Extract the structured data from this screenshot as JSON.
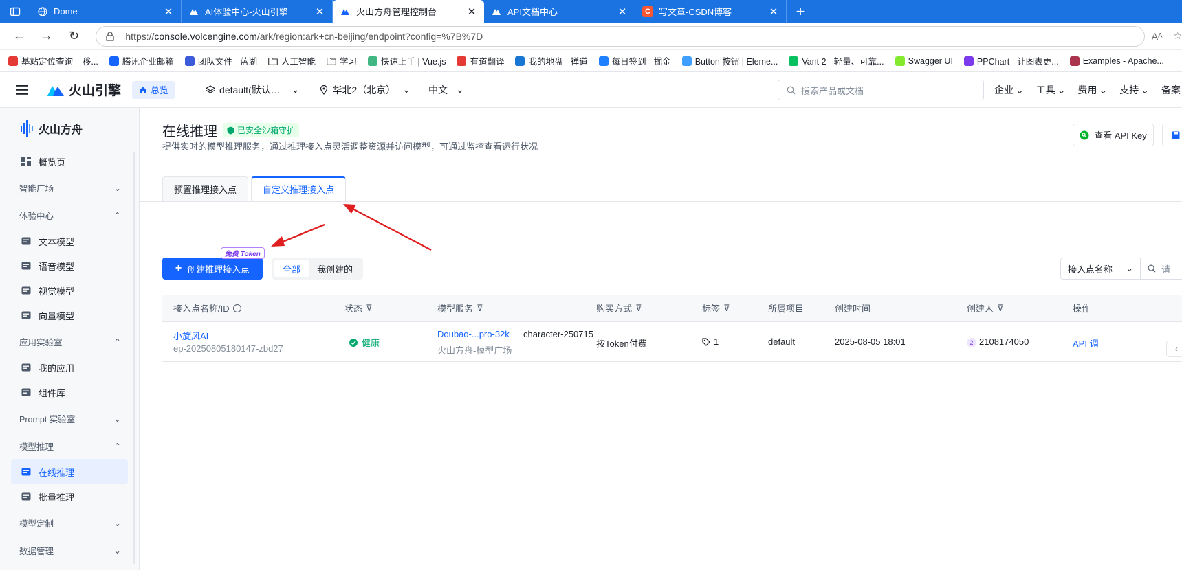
{
  "browser": {
    "tabs": [
      {
        "title": "Dome",
        "icon": "globe-icon"
      },
      {
        "title": "AI体验中心-火山引擎",
        "icon": "volcengine-icon"
      },
      {
        "title": "火山方舟管理控制台",
        "icon": "volcengine-icon",
        "active": true
      },
      {
        "title": "API文档中心",
        "icon": "volcengine-icon"
      },
      {
        "title": "写文章-CSDN博客",
        "icon": "csdn-icon"
      }
    ],
    "url_prefix": "https://",
    "url_host": "console.volcengine.com",
    "url_rest": "/ark/region:ark+cn-beijing/endpoint?config=%7B%7D",
    "bookmarks": [
      {
        "label": "基站定位查询 – 移...",
        "color": "#e53935"
      },
      {
        "label": "腾讯企业邮箱",
        "color": "#1664ff"
      },
      {
        "label": "团队文件 - 蓝湖",
        "color": "#3b5bdb"
      },
      {
        "label": "人工智能",
        "color": "folder"
      },
      {
        "label": "学习",
        "color": "folder"
      },
      {
        "label": "快速上手 | Vue.js",
        "color": "#41b883"
      },
      {
        "label": "有道翻译",
        "color": "#e53935"
      },
      {
        "label": "我的地盘 - 禅道",
        "color": "#1976d2"
      },
      {
        "label": "每日签到 - 掘金",
        "color": "#1e80ff"
      },
      {
        "label": "Button 按钮 | Eleme...",
        "color": "#409eff"
      },
      {
        "label": "Vant 2 - 轻量、可靠...",
        "color": "#07c160"
      },
      {
        "label": "Swagger UI",
        "color": "#85ea2d"
      },
      {
        "label": "PPChart - 让图表更...",
        "color": "#7c3aed"
      },
      {
        "label": "Examples - Apache...",
        "color": "#aa344d"
      }
    ]
  },
  "header": {
    "brand": "火山引擎",
    "home": "总览",
    "project": "default(默认…",
    "region": "华北2（北京）",
    "lang": "中文",
    "search_placeholder": "搜索产品或文档",
    "menus": [
      "企业",
      "工具",
      "费用",
      "支持",
      "备案"
    ]
  },
  "sidebar": {
    "brand": "火山方舟",
    "overview": "概览页",
    "groups": [
      {
        "label": "智能广场",
        "expanded": false,
        "items": []
      },
      {
        "label": "体验中心",
        "expanded": true,
        "items": [
          "文本模型",
          "语音模型",
          "视觉模型",
          "向量模型"
        ]
      },
      {
        "label": "应用实验室",
        "expanded": true,
        "items": [
          "我的应用",
          "组件库"
        ]
      },
      {
        "label": "Prompt 实验室",
        "expanded": false,
        "items": []
      },
      {
        "label": "模型推理",
        "expanded": true,
        "items": [
          "在线推理",
          "批量推理"
        ]
      },
      {
        "label": "模型定制",
        "expanded": false,
        "items": []
      },
      {
        "label": "数据管理",
        "expanded": false,
        "items": []
      }
    ],
    "active_item": "在线推理"
  },
  "page": {
    "title": "在线推理",
    "sandbox_badge": "已安全沙箱守护",
    "description": "提供实时的模型推理服务，通过推理接入点灵活调整资源并访问模型，可通过监控查看运行状况",
    "api_key_button": "查看 API Key",
    "tabs": [
      "预置推理接入点",
      "自定义推理接入点"
    ],
    "active_tab": "自定义推理接入点",
    "create_button": "创建推理接入点",
    "free_badge": "免费 Token",
    "segments": [
      "全部",
      "我创建的"
    ],
    "active_segment": "全部",
    "filter_select": "接入点名称",
    "filter_search_placeholder": "请"
  },
  "table": {
    "columns": [
      "接入点名称/ID",
      "状态",
      "模型服务",
      "购买方式",
      "标签",
      "所属项目",
      "创建时间",
      "创建人",
      "操作"
    ],
    "rows": [
      {
        "name": "小旋风AI",
        "id": "ep-20250805180147-zbd27",
        "status": "健康",
        "model": "Doubao-...pro-32k",
        "model_version": "character-250715",
        "model_source": "火山方舟-模型广场",
        "purchase": "按Token付费",
        "tags": "1",
        "project": "default",
        "created": "2025-08-05 18:01",
        "creator_badge": "2",
        "creator": "2108174050",
        "action": "API 调"
      }
    ]
  },
  "colors": {
    "primary": "#1664ff",
    "browser_tab_bar": "#1b73e2",
    "health_green": "#00a870",
    "arrow_red": "#e02020"
  }
}
